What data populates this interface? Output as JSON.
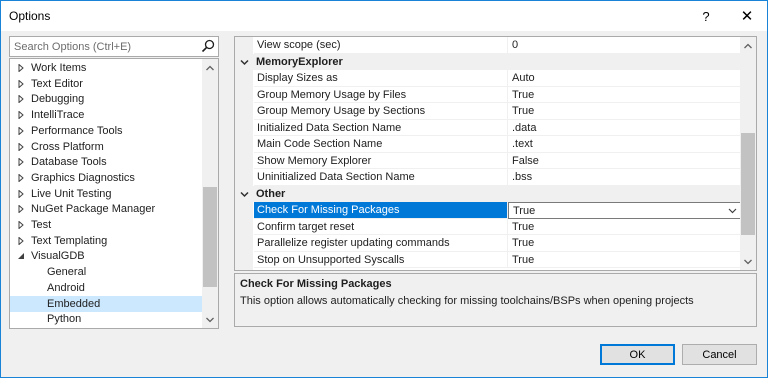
{
  "window": {
    "title": "Options",
    "help_glyph": "?",
    "close_glyph": "✕"
  },
  "search": {
    "placeholder": "Search Options (Ctrl+E)"
  },
  "tree": {
    "items": [
      {
        "label": "Work Items",
        "expanded": false,
        "selected": false,
        "child": false
      },
      {
        "label": "Text Editor",
        "expanded": false,
        "selected": false,
        "child": false
      },
      {
        "label": "Debugging",
        "expanded": false,
        "selected": false,
        "child": false
      },
      {
        "label": "IntelliTrace",
        "expanded": false,
        "selected": false,
        "child": false
      },
      {
        "label": "Performance Tools",
        "expanded": false,
        "selected": false,
        "child": false
      },
      {
        "label": "Cross Platform",
        "expanded": false,
        "selected": false,
        "child": false
      },
      {
        "label": "Database Tools",
        "expanded": false,
        "selected": false,
        "child": false
      },
      {
        "label": "Graphics Diagnostics",
        "expanded": false,
        "selected": false,
        "child": false
      },
      {
        "label": "Live Unit Testing",
        "expanded": false,
        "selected": false,
        "child": false
      },
      {
        "label": "NuGet Package Manager",
        "expanded": false,
        "selected": false,
        "child": false
      },
      {
        "label": "Test",
        "expanded": false,
        "selected": false,
        "child": false
      },
      {
        "label": "Text Templating",
        "expanded": false,
        "selected": false,
        "child": false
      },
      {
        "label": "VisualGDB",
        "expanded": true,
        "selected": false,
        "child": false
      },
      {
        "label": "General",
        "expanded": false,
        "selected": false,
        "child": true
      },
      {
        "label": "Android",
        "expanded": false,
        "selected": false,
        "child": true
      },
      {
        "label": "Embedded",
        "expanded": false,
        "selected": true,
        "child": true
      },
      {
        "label": "Python",
        "expanded": false,
        "selected": false,
        "child": true
      }
    ]
  },
  "grid": {
    "rows": [
      {
        "kind": "prop",
        "name": "View scope (sec)",
        "value": "0"
      },
      {
        "kind": "category",
        "name": "MemoryExplorer"
      },
      {
        "kind": "prop",
        "name": "Display Sizes as",
        "value": "Auto"
      },
      {
        "kind": "prop",
        "name": "Group Memory Usage by Files",
        "value": "True"
      },
      {
        "kind": "prop",
        "name": "Group Memory Usage by Sections",
        "value": "True"
      },
      {
        "kind": "prop",
        "name": "Initialized Data Section Name",
        "value": ".data"
      },
      {
        "kind": "prop",
        "name": "Main Code Section Name",
        "value": ".text"
      },
      {
        "kind": "prop",
        "name": "Show Memory Explorer",
        "value": "False"
      },
      {
        "kind": "prop",
        "name": "Uninitialized Data Section Name",
        "value": ".bss"
      },
      {
        "kind": "category",
        "name": "Other"
      },
      {
        "kind": "prop",
        "name": "Check For Missing Packages",
        "value": "True",
        "selected": true
      },
      {
        "kind": "prop",
        "name": "Confirm target reset",
        "value": "True"
      },
      {
        "kind": "prop",
        "name": "Parallelize register updating commands",
        "value": "True"
      },
      {
        "kind": "prop",
        "name": "Stop on Unsupported Syscalls",
        "value": "True"
      }
    ]
  },
  "description": {
    "title": "Check For Missing Packages",
    "text": "This option allows automatically checking for missing toolchains/BSPs when opening projects"
  },
  "buttons": {
    "ok": "OK",
    "cancel": "Cancel"
  },
  "colors": {
    "accent": "#0078d7",
    "selected_tree": "#cce8ff",
    "border": "#aaaaaa",
    "window_border": "#1883d7"
  }
}
